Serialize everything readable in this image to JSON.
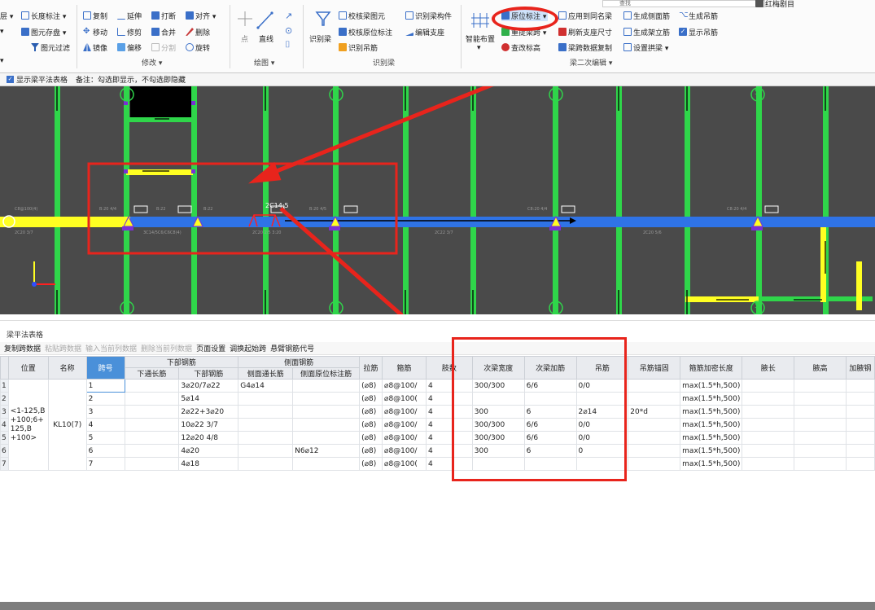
{
  "ribbon": {
    "search_placeholder": "查找",
    "user_label": "红梅剧目",
    "col1": [
      "层 ▾",
      "▾",
      "▾"
    ],
    "col2": [
      "长度标注 ▾",
      "图元存盘 ▾",
      "图元过滤"
    ],
    "col3a": [
      "复制",
      "移动",
      "镜像"
    ],
    "col3b": [
      "延伸",
      "修剪",
      "偏移"
    ],
    "col3c": [
      "打断",
      "合并",
      "分割"
    ],
    "col3d": [
      "对齐 ▾",
      "删除",
      "旋转"
    ],
    "modify_group": "修改 ▾",
    "draw_point": "点",
    "draw_line": "直线",
    "draw_group": "绘图 ▾",
    "identify_beam": "识别梁",
    "id_col1": [
      "校核梁图元",
      "校核原位标注",
      "识别吊筋"
    ],
    "id_col2": [
      "识别梁构件",
      "编辑支座"
    ],
    "identify_group": "识别梁",
    "smart_layout": "智能布置",
    "smart_arrow": "▾",
    "b2_col1": [
      "原位标注 ▾",
      "重提梁跨 ▾",
      "查改标高"
    ],
    "b2_col2": [
      "应用到同名梁",
      "刷新支座尺寸",
      "梁跨数据复制"
    ],
    "b2_col3": [
      "生成侧面筋",
      "生成架立筋",
      "设置拱梁 ▾"
    ],
    "b2_col4": [
      "生成吊筋",
      "显示吊筋"
    ],
    "beam2_group": "梁二次编辑 ▾"
  },
  "optbar": {
    "checkbox_label": "显示梁平法表格",
    "note": "备注：勾选即显示，不勾选即隐藏"
  },
  "canvas": {
    "axis_numbers": [
      "2",
      "3",
      "4",
      "5",
      "2",
      "3",
      "4",
      "5"
    ],
    "label_2c14": "2C14:5",
    "beam_texts": [
      "C8@100(4)",
      "B:20 4/4",
      "B:22",
      "B:22",
      "B:20 4/5",
      "C8:20 4/4",
      "C8:20 4/4",
      "2C20 3/7",
      "3C14/5C6/C6C8(4)",
      "2C20 2/5 3:20",
      "2C22 3/7",
      "2C20 5/6"
    ]
  },
  "panel": {
    "title": "梁平法表格",
    "toolbar": [
      "复制跨数据",
      "粘贴跨数据",
      "输入当前列数据",
      "删除当前列数据",
      "页面设置",
      "调换起始跨",
      "悬臂钢筋代号"
    ],
    "toolbar_disabled": [
      false,
      true,
      true,
      true,
      false,
      false,
      false
    ]
  },
  "table": {
    "headers_top": [
      "位置",
      "名称",
      "跨号",
      "下部钢筋",
      "侧面钢筋",
      "拉筋",
      "箍筋",
      "肢数",
      "次梁宽度",
      "次梁加筋",
      "吊筋",
      "吊筋锚固",
      "箍筋加密长度",
      "腋长",
      "腋高",
      "加腋钢"
    ],
    "sub_bottom": [
      "下通长筋",
      "下部钢筋"
    ],
    "sub_side": [
      "侧面通长筋",
      "侧面原位标注筋"
    ],
    "position": "<1-125,B +100;6+ 125,B +100>",
    "name": "KL10(7)",
    "rows": [
      {
        "rn": "1",
        "span": "1",
        "through": "",
        "bottom": "3⌀20/7⌀22",
        "side_through": "G4⌀14",
        "side_orig": "",
        "tie": "(⌀8)",
        "stirrup": "⌀8@100/",
        "legs": "4",
        "sec_w": "300/300",
        "sec_add": "6/6",
        "hanger": "0/0",
        "anchor": "",
        "dense": "max(1.5*h,500)"
      },
      {
        "rn": "2",
        "span": "2",
        "through": "",
        "bottom": "5⌀14",
        "side_through": "",
        "side_orig": "",
        "tie": "(⌀8)",
        "stirrup": "⌀8@100(",
        "legs": "4",
        "sec_w": "",
        "sec_add": "",
        "hanger": "",
        "anchor": "",
        "dense": "max(1.5*h,500)"
      },
      {
        "rn": "3",
        "span": "3",
        "through": "",
        "bottom": "2⌀22+3⌀20",
        "side_through": "",
        "side_orig": "",
        "tie": "(⌀8)",
        "stirrup": "⌀8@100/",
        "legs": "4",
        "sec_w": "300",
        "sec_add": "6",
        "hanger": "2⌀14",
        "anchor": "20*d",
        "dense": "max(1.5*h,500)"
      },
      {
        "rn": "4",
        "span": "4",
        "through": "",
        "bottom": "10⌀22 3/7",
        "side_through": "",
        "side_orig": "",
        "tie": "(⌀8)",
        "stirrup": "⌀8@100/",
        "legs": "4",
        "sec_w": "300/300",
        "sec_add": "6/6",
        "hanger": "0/0",
        "anchor": "",
        "dense": "max(1.5*h,500)"
      },
      {
        "rn": "5",
        "span": "5",
        "through": "",
        "bottom": "12⌀20 4/8",
        "side_through": "",
        "side_orig": "",
        "tie": "(⌀8)",
        "stirrup": "⌀8@100/",
        "legs": "4",
        "sec_w": "300/300",
        "sec_add": "6/6",
        "hanger": "0/0",
        "anchor": "",
        "dense": "max(1.5*h,500)"
      },
      {
        "rn": "6",
        "span": "6",
        "through": "",
        "bottom": "4⌀20",
        "side_through": "",
        "side_orig": "N6⌀12",
        "tie": "(⌀8)",
        "stirrup": "⌀8@100/",
        "legs": "4",
        "sec_w": "300",
        "sec_add": "6",
        "hanger": "0",
        "anchor": "",
        "dense": "max(1.5*h,500)"
      },
      {
        "rn": "7",
        "span": "7",
        "through": "",
        "bottom": "4⌀18",
        "side_through": "",
        "side_orig": "",
        "tie": "(⌀8)",
        "stirrup": "⌀8@100(",
        "legs": "4",
        "sec_w": "",
        "sec_add": "",
        "hanger": "",
        "anchor": "",
        "dense": "max(1.5*h,500)"
      }
    ]
  },
  "colors": {
    "beam": "#2f73e6",
    "column": "#2fd64a",
    "highlight": "#ffff22",
    "annotation": "#e8241c",
    "selected_header": "#4a90d9"
  }
}
